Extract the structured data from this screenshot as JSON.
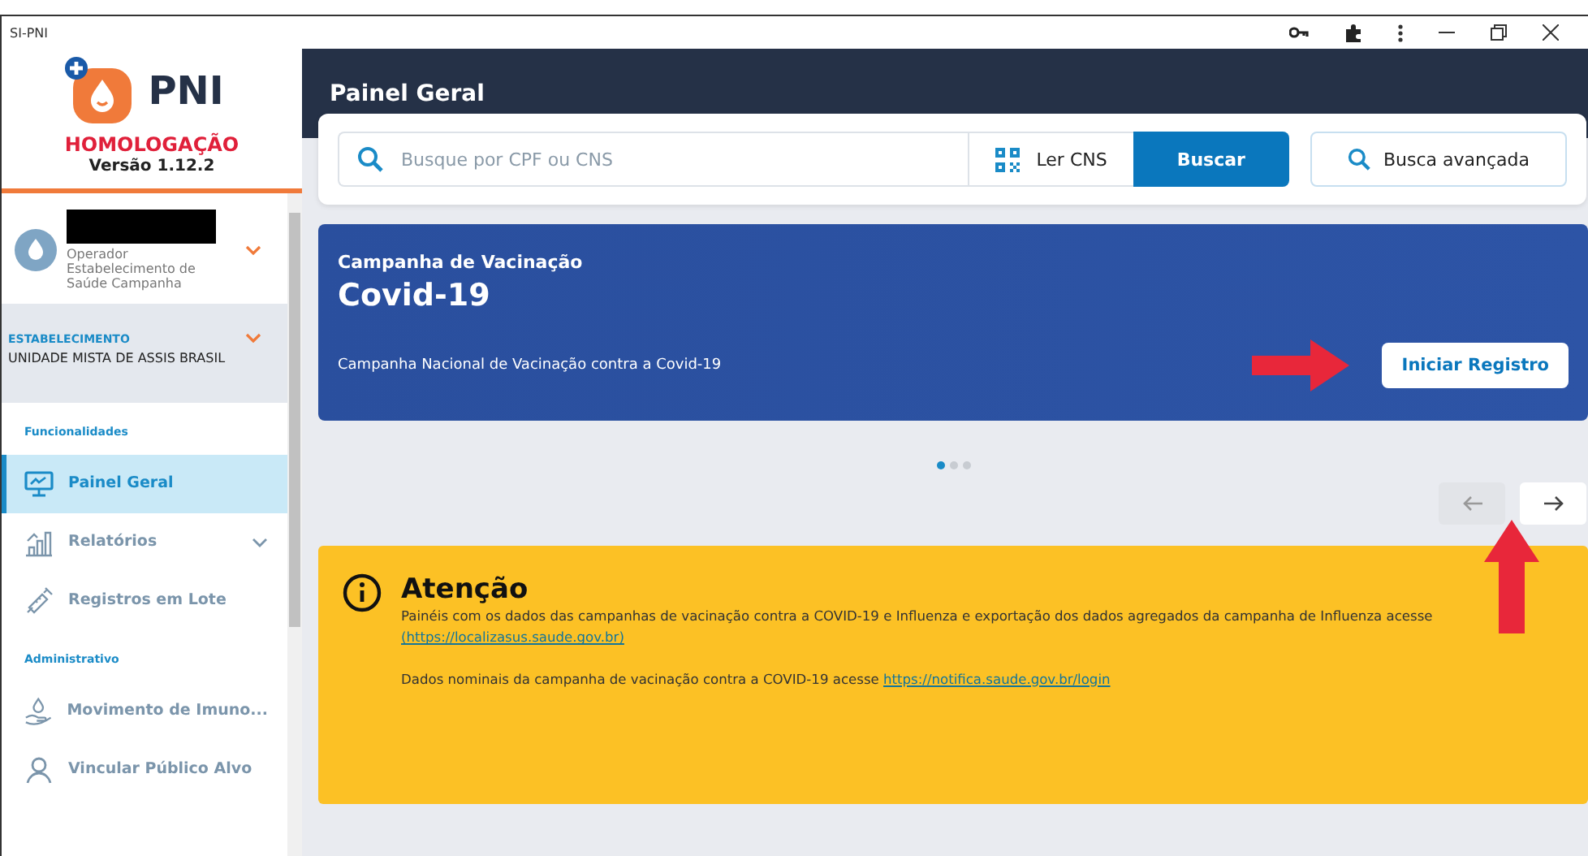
{
  "window": {
    "title": "SI-PNI"
  },
  "sidebar": {
    "logo": "PNI",
    "environment": "HOMOLOGAÇÃO",
    "version": "Versão 1.12.2",
    "user": {
      "role": "Operador",
      "unit": "Estabelecimento de Saúde Campanha"
    },
    "establishment": {
      "label": "ESTABELECIMENTO",
      "name": "UNIDADE MISTA DE ASSIS BRASIL"
    },
    "sections": [
      {
        "title": "Funcionalidades",
        "items": [
          {
            "label": "Painel Geral",
            "kind": "monitor",
            "selected": true,
            "expandable": false
          },
          {
            "label": "Relatórios",
            "kind": "chart",
            "selected": false,
            "expandable": true
          },
          {
            "label": "Registros em Lote",
            "kind": "syringe",
            "selected": false,
            "expandable": false
          }
        ]
      },
      {
        "title": "Administrativo",
        "items": [
          {
            "label": "Movimento de Imuno...",
            "kind": "hand",
            "selected": false,
            "expandable": false
          },
          {
            "label": "Vincular Público Alvo",
            "kind": "person",
            "selected": false,
            "expandable": false
          }
        ]
      }
    ]
  },
  "header": {
    "title": "Painel Geral"
  },
  "search": {
    "placeholder": "Busque por CPF ou CNS",
    "read_button": "Ler CNS",
    "search_button": "Buscar",
    "advanced_button": "Busca avançada"
  },
  "banner": {
    "kicker": "Campanha de Vacinação",
    "title": "Covid-19",
    "description": "Campanha Nacional de Vacinação contra a Covid-19",
    "button": "Iniciar Registro"
  },
  "carousel": {
    "dots": [
      {
        "selected": true
      },
      {
        "selected": false
      },
      {
        "selected": false
      }
    ],
    "prev_disabled": true,
    "next_disabled": false
  },
  "alert": {
    "title": "Atenção",
    "paragraphs": [
      {
        "text": "Painéis com os dados das campanhas de vacinação contra a COVID-19 e Influenza e exportação dos dados agregados da campanha de Influenza acesse",
        "link": "(https://localizasus.saude.gov.br)"
      },
      {
        "text": "Dados nominais da campanha de vacinação contra a COVID-19 acesse",
        "link": "https://notifica.saude.gov.br/login"
      }
    ]
  }
}
